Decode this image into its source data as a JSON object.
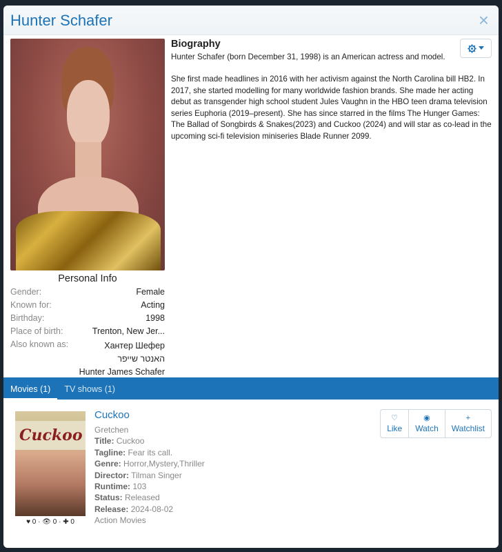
{
  "modal": {
    "title": "Hunter Schafer",
    "close_icon": "×"
  },
  "personal": {
    "heading": "Personal Info",
    "gender_label": "Gender:",
    "gender": "Female",
    "known_for_label": "Known for:",
    "known_for": "Acting",
    "birthday_label": "Birthday:",
    "birthday": "1998",
    "birthplace_label": "Place of birth:",
    "birthplace": "Trenton, New Jer...",
    "aka_label": "Also known as:",
    "aka": [
      "Хантер Шефер",
      "האנטר שייפר",
      "Hunter James Schafer"
    ]
  },
  "bio": {
    "heading": "Biography",
    "p1": "Hunter Schafer (born December 31, 1998) is an American actress and model.",
    "p2": "She first made headlines in 2016 with her activism against the North Carolina bill HB2. In 2017, she started modelling for many worldwide fashion brands. She made her acting debut as transgender high school student Jules Vaughn in the HBO teen drama television series Euphoria (2019–present). She has since starred in the films The Hunger Games: The Ballad of Songbirds & Snakes(2023) and Cuckoo (2024) and will star as co-lead in the upcoming sci-fi television miniseries Blade Runner 2099."
  },
  "settings": {
    "icon": "gear-icon"
  },
  "tabs": [
    {
      "label": "Movies (1)",
      "active": true
    },
    {
      "label": "TV shows (1)",
      "active": false
    }
  ],
  "movie": {
    "poster_word": "Cuckoo",
    "title": "Cuckoo",
    "character": "Gretchen",
    "fields": [
      {
        "label": "Title:",
        "value": " Cuckoo"
      },
      {
        "label": "Tagline:",
        "value": " Fear its call."
      },
      {
        "label": "Genre:",
        "value": " Horror,Mystery,Thriller"
      },
      {
        "label": "Director:",
        "value": " Tilman Singer"
      },
      {
        "label": "Runtime:",
        "value": " 103"
      },
      {
        "label": "Status:",
        "value": " Released"
      },
      {
        "label": "Release:",
        "value": " 2024-08-02"
      }
    ],
    "list": "Action Movies",
    "stats": {
      "likes": "0",
      "watches": "0",
      "watchlist": "0"
    }
  },
  "actions": {
    "like": "Like",
    "watch": "Watch",
    "watchlist": "Watchlist"
  },
  "colors": {
    "accent": "#1c73b8",
    "muted": "#888888"
  }
}
